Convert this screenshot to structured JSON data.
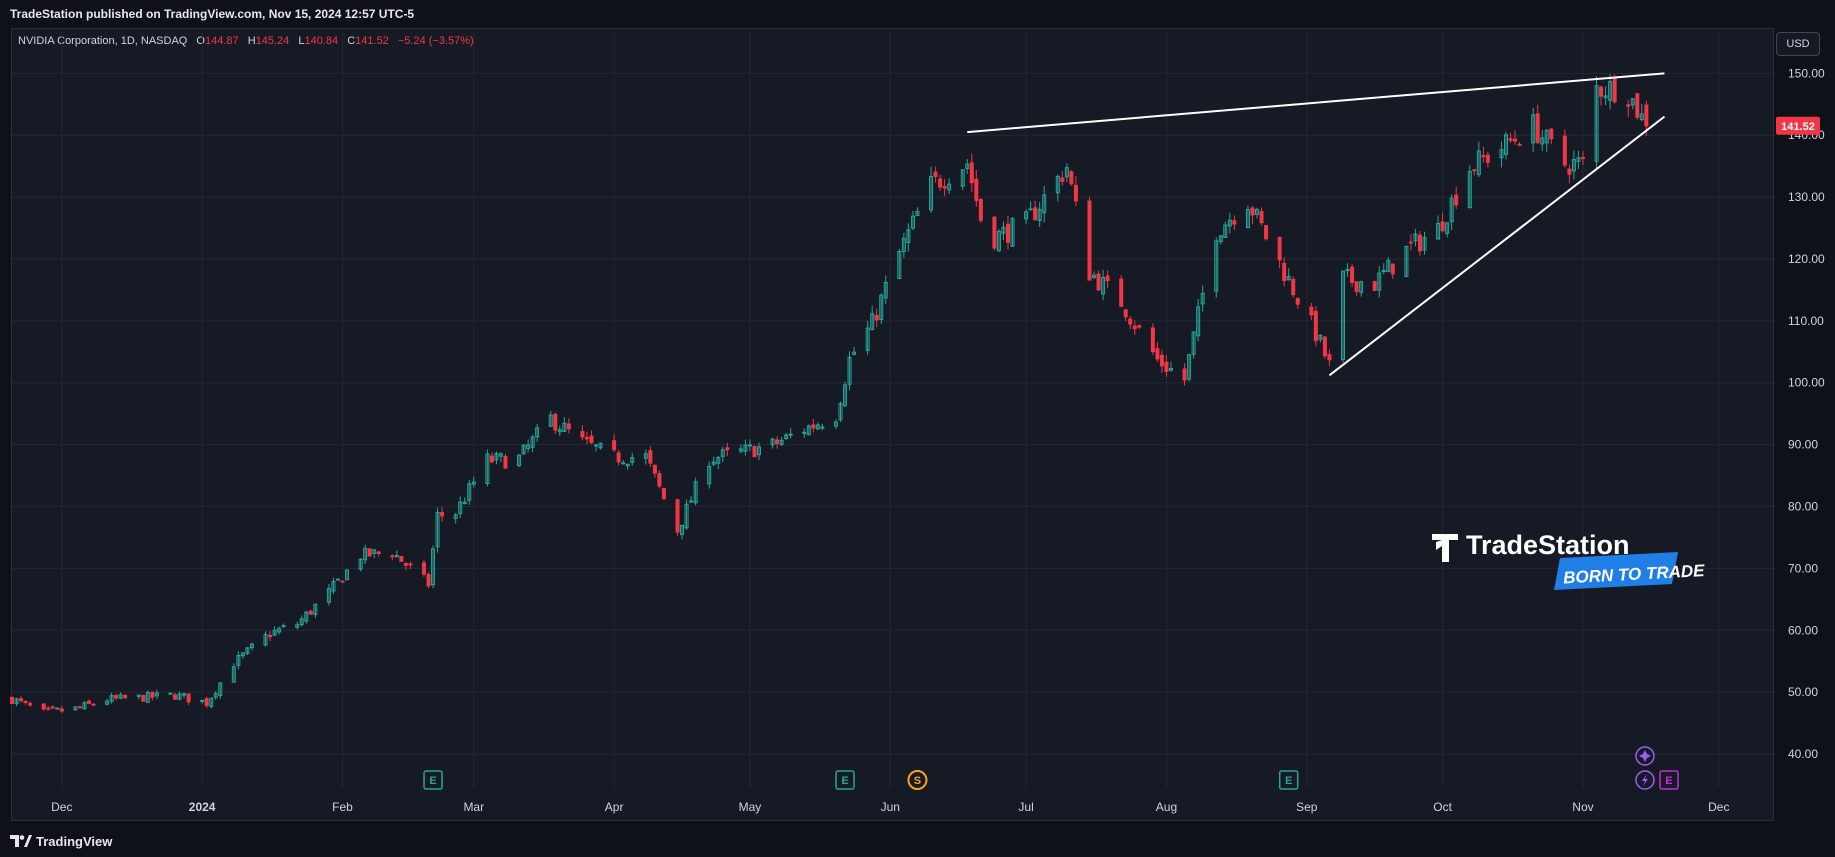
{
  "header": {
    "published": "TradeStation published on TradingView.com, Nov 15, 2024 12:57 UTC-5"
  },
  "legend": {
    "symbol": "NVIDIA Corporation, 1D, NASDAQ",
    "open_label": "O",
    "open": "144.87",
    "high_label": "H",
    "high": "145.24",
    "low_label": "L",
    "low": "140.84",
    "close_label": "C",
    "close": "141.52",
    "change": "−5.24 (−3.57%)"
  },
  "currency_button": "USD",
  "footer": {
    "brand": "TradingView"
  },
  "watermark": {
    "brand": "TradeStation",
    "tagline": "BORN TO TRADE"
  },
  "colors": {
    "up": "#26a69a",
    "down": "#f23645",
    "background": "#161a25",
    "grid": "#242834",
    "trendline": "#ffffff",
    "price_label": "#f23645",
    "earnings": "#26a69a",
    "dividend": "#f7a21b",
    "event_purple": "#9c5cf5",
    "earnings_purple": "#c22ee0"
  },
  "chart_data": {
    "type": "candlestick",
    "title": "NVIDIA Corporation, 1D, NASDAQ",
    "ylim": [
      35,
      157
    ],
    "y_ticks": [
      40,
      50,
      60,
      70,
      80,
      90,
      100,
      110,
      120,
      130,
      140,
      150
    ],
    "y_tick_labels": [
      "40.00",
      "50.00",
      "60.00",
      "70.00",
      "80.00",
      "90.00",
      "100.00",
      "110.00",
      "120.00",
      "130.00",
      "140.00",
      "150.00"
    ],
    "x_range": [
      "2023-11-20",
      "2024-12-09"
    ],
    "x_ticks": [
      {
        "date": "2023-12-01",
        "label": "Dec"
      },
      {
        "date": "2024-01-01",
        "label": "2024"
      },
      {
        "date": "2024-02-01",
        "label": "Feb"
      },
      {
        "date": "2024-03-01",
        "label": "Mar"
      },
      {
        "date": "2024-04-01",
        "label": "Apr"
      },
      {
        "date": "2024-05-01",
        "label": "May"
      },
      {
        "date": "2024-06-01",
        "label": "Jun"
      },
      {
        "date": "2024-07-01",
        "label": "Jul"
      },
      {
        "date": "2024-08-01",
        "label": "Aug"
      },
      {
        "date": "2024-09-01",
        "label": "Sep"
      },
      {
        "date": "2024-10-01",
        "label": "Oct"
      },
      {
        "date": "2024-11-01",
        "label": "Nov"
      },
      {
        "date": "2024-12-01",
        "label": "Dec"
      }
    ],
    "grid": true,
    "last_price": 141.52,
    "last_price_label": "141.52",
    "closes": [
      {
        "date": "2023-11-20",
        "close": 48.9
      },
      {
        "date": "2023-11-27",
        "close": 46.7
      },
      {
        "date": "2023-12-04",
        "close": 47.3
      },
      {
        "date": "2023-12-11",
        "close": 48.8
      },
      {
        "date": "2023-12-18",
        "close": 49.1
      },
      {
        "date": "2023-12-26",
        "close": 49.5
      },
      {
        "date": "2024-01-02",
        "close": 48.3
      },
      {
        "date": "2024-01-08",
        "close": 54.7
      },
      {
        "date": "2024-01-16",
        "close": 59.5
      },
      {
        "date": "2024-01-22",
        "close": 61.0
      },
      {
        "date": "2024-01-29",
        "close": 66.1
      },
      {
        "date": "2024-02-05",
        "close": 72.1
      },
      {
        "date": "2024-02-12",
        "close": 72.6
      },
      {
        "date": "2024-02-20",
        "close": 67.5
      },
      {
        "date": "2024-02-22",
        "close": 78.5
      },
      {
        "date": "2024-02-26",
        "close": 79.0
      },
      {
        "date": "2024-03-04",
        "close": 87.5
      },
      {
        "date": "2024-03-08",
        "close": 87.5
      },
      {
        "date": "2024-03-11",
        "close": 87.8
      },
      {
        "date": "2024-03-18",
        "close": 94.2
      },
      {
        "date": "2024-03-25",
        "close": 90.4
      },
      {
        "date": "2024-04-01",
        "close": 88.0
      },
      {
        "date": "2024-04-08",
        "close": 88.0
      },
      {
        "date": "2024-04-15",
        "close": 76.2
      },
      {
        "date": "2024-04-22",
        "close": 87.7
      },
      {
        "date": "2024-04-29",
        "close": 88.8
      },
      {
        "date": "2024-05-06",
        "close": 89.9
      },
      {
        "date": "2024-05-13",
        "close": 92.5
      },
      {
        "date": "2024-05-20",
        "close": 94.8
      },
      {
        "date": "2024-05-23",
        "close": 103.8
      },
      {
        "date": "2024-05-28",
        "close": 109.6
      },
      {
        "date": "2024-06-03",
        "close": 120.9
      },
      {
        "date": "2024-06-10",
        "close": 131.9
      },
      {
        "date": "2024-06-18",
        "close": 135.6
      },
      {
        "date": "2024-06-21",
        "close": 126.6
      },
      {
        "date": "2024-06-24",
        "close": 123.5
      },
      {
        "date": "2024-07-01",
        "close": 125.8
      },
      {
        "date": "2024-07-10",
        "close": 134.9
      },
      {
        "date": "2024-07-15",
        "close": 117.9
      },
      {
        "date": "2024-07-22",
        "close": 113.1
      },
      {
        "date": "2024-07-30",
        "close": 103.7
      },
      {
        "date": "2024-08-05",
        "close": 100.5
      },
      {
        "date": "2024-08-12",
        "close": 124.6
      },
      {
        "date": "2024-08-19",
        "close": 129.4
      },
      {
        "date": "2024-08-26",
        "close": 119.4
      },
      {
        "date": "2024-09-03",
        "close": 108.0
      },
      {
        "date": "2024-09-06",
        "close": 102.8
      },
      {
        "date": "2024-09-09",
        "close": 116.8
      },
      {
        "date": "2024-09-16",
        "close": 116.0
      },
      {
        "date": "2024-09-23",
        "close": 121.4
      },
      {
        "date": "2024-09-30",
        "close": 124.9
      },
      {
        "date": "2024-10-07",
        "close": 134.8
      },
      {
        "date": "2024-10-14",
        "close": 138.0
      },
      {
        "date": "2024-10-21",
        "close": 141.5
      },
      {
        "date": "2024-10-28",
        "close": 135.4
      },
      {
        "date": "2024-11-01",
        "close": 135.4
      },
      {
        "date": "2024-11-04",
        "close": 147.6
      },
      {
        "date": "2024-11-08",
        "close": 147.6
      },
      {
        "date": "2024-11-11",
        "close": 146.8
      },
      {
        "date": "2024-11-15",
        "close": 141.5
      }
    ],
    "trendlines": [
      {
        "name": "upper",
        "from": {
          "date": "2024-06-18",
          "price": 140.5
        },
        "to": {
          "date": "2024-11-19",
          "price": 150.0
        }
      },
      {
        "name": "lower",
        "from": {
          "date": "2024-09-06",
          "price": 101.2
        },
        "to": {
          "date": "2024-11-19",
          "price": 143.0
        }
      }
    ],
    "events": [
      {
        "date": "2024-02-21",
        "label": "E",
        "kind": "earnings"
      },
      {
        "date": "2024-05-22",
        "label": "E",
        "kind": "earnings"
      },
      {
        "date": "2024-06-07",
        "label": "S",
        "kind": "split"
      },
      {
        "date": "2024-08-28",
        "label": "E",
        "kind": "earnings"
      },
      {
        "date": "2024-11-20",
        "label": "E",
        "kind": "earnings-upcoming"
      }
    ]
  }
}
